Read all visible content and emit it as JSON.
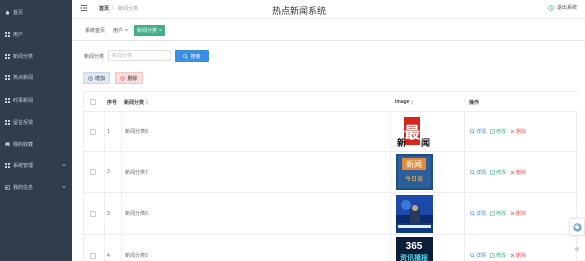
{
  "sidebar": {
    "items": [
      {
        "label": "首页",
        "icon": "home-icon"
      },
      {
        "label": "用户",
        "icon": "grid-icon"
      },
      {
        "label": "新闻分类",
        "icon": "grid-icon"
      },
      {
        "label": "热点新闻",
        "icon": "grid-icon"
      },
      {
        "label": "时事新闻",
        "icon": "grid-icon"
      },
      {
        "label": "留言反馈",
        "icon": "grid-icon"
      },
      {
        "label": "我的收藏",
        "icon": "bookmark-icon"
      },
      {
        "label": "系统管理",
        "icon": "grid-icon",
        "expandable": true
      },
      {
        "label": "我的信息",
        "icon": "card-icon",
        "expandable": true
      }
    ]
  },
  "header": {
    "breadcrumb_home": "首页",
    "breadcrumb_sep": "/",
    "breadcrumb_current": "新闻分类",
    "title": "热点新闻系统",
    "logout": "退出系统"
  },
  "tabs": {
    "t1": "系统首页",
    "t2": "用户",
    "t2_close": "×",
    "t3": "新闻分类",
    "t3_close": "×"
  },
  "search": {
    "label": "新闻分类",
    "placeholder": "新闻分类",
    "button": "搜索"
  },
  "actions": {
    "add": "增加",
    "delete": "删除"
  },
  "table": {
    "headers": {
      "index": "序号",
      "category": "新闻分类",
      "image": "image",
      "operation": "操作"
    },
    "ops": {
      "detail": "详情",
      "edit": "修改",
      "remove": "删除"
    },
    "rows": [
      {
        "index": "1",
        "category": "新闻分类8",
        "thumb_text": "新最闻"
      },
      {
        "index": "2",
        "category": "新闻分类7",
        "thumb_text": "新闻",
        "thumb_sub": "今日谈"
      },
      {
        "index": "3",
        "category": "新闻分类6",
        "thumb_text": ""
      },
      {
        "index": "4",
        "category": "新闻分类5",
        "thumb_text": "365",
        "thumb_sub": "资讯播报"
      }
    ]
  },
  "colors": {
    "sidebar_bg": "#2f3d4d",
    "accent_green": "#3fb08a",
    "primary_blue": "#3a8ee6",
    "danger_red": "#e05656"
  }
}
